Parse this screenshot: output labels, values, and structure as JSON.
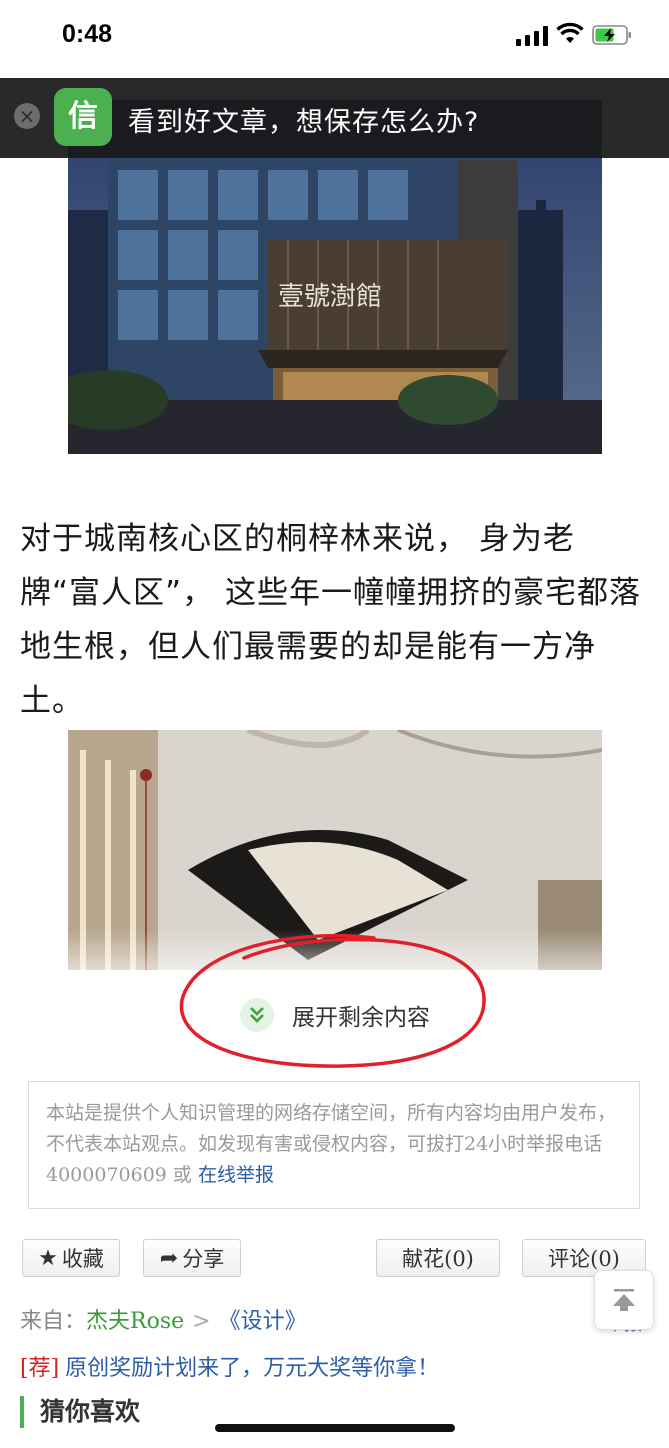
{
  "status_bar": {
    "time": "0:48"
  },
  "banner": {
    "close_icon": "close-icon",
    "logo_icon": "app-logo-icon",
    "logo_text": "信",
    "text": "看到好文章，想保存怎么办?"
  },
  "article": {
    "paragraph": "对于城南核心区的桐梓林来说， 身为老牌“富人区”， 这些年一幢幢拥挤的豪宅都落地生根，但人们最需要的却是能有一方净土。",
    "building_sign": "壹號澍館"
  },
  "expand": {
    "label": "展开剩余内容",
    "icon": "chevron-double-down-icon"
  },
  "disclaimer": {
    "text": "本站是提供个人知识管理的网络存储空间，所有内容均由用户发布，不代表本站观点。如发现有害或侵权内容，可拔打24小时举报电话4000070609 或 ",
    "report_link": "在线举报"
  },
  "actions": {
    "collect": "收藏",
    "share": "分享",
    "flower": "献花(0)",
    "comment": "评论(0)",
    "report_peek": "举报"
  },
  "source": {
    "prefix": "来自：",
    "author": "杰夫Rose",
    "separator": ">",
    "category": "《设计》"
  },
  "promo": {
    "tag": "[荐]",
    "text": "原创奖励计划来了，万元大奖等你拿！"
  },
  "section": {
    "guess": "猜你喜欢"
  },
  "colors": {
    "accent_green": "#4caf50",
    "link_blue": "#2b5ea8",
    "tag_red": "#d2231f",
    "annotation_red": "#e0202a"
  }
}
